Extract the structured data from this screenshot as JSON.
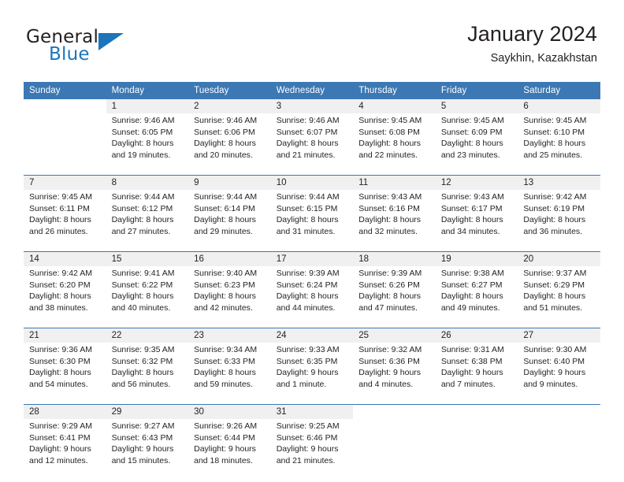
{
  "brand": {
    "name_part1": "General",
    "name_part2": "Blue",
    "logo_icon": "triangle-icon"
  },
  "header": {
    "month_title": "January 2024",
    "location": "Saykhin, Kazakhstan"
  },
  "colors": {
    "header_band": "#3c78b4",
    "daynum_band": "#f0f0f0",
    "brand_blue": "#1b75bb",
    "text": "#231f20"
  },
  "weekday_headers": [
    "Sunday",
    "Monday",
    "Tuesday",
    "Wednesday",
    "Thursday",
    "Friday",
    "Saturday"
  ],
  "weeks": [
    {
      "days": [
        {
          "num": "",
          "empty": true,
          "l1": "",
          "l2": "",
          "l3": "",
          "l4": ""
        },
        {
          "num": "1",
          "l1": "Sunrise: 9:46 AM",
          "l2": "Sunset: 6:05 PM",
          "l3": "Daylight: 8 hours",
          "l4": "and 19 minutes."
        },
        {
          "num": "2",
          "l1": "Sunrise: 9:46 AM",
          "l2": "Sunset: 6:06 PM",
          "l3": "Daylight: 8 hours",
          "l4": "and 20 minutes."
        },
        {
          "num": "3",
          "l1": "Sunrise: 9:46 AM",
          "l2": "Sunset: 6:07 PM",
          "l3": "Daylight: 8 hours",
          "l4": "and 21 minutes."
        },
        {
          "num": "4",
          "l1": "Sunrise: 9:45 AM",
          "l2": "Sunset: 6:08 PM",
          "l3": "Daylight: 8 hours",
          "l4": "and 22 minutes."
        },
        {
          "num": "5",
          "l1": "Sunrise: 9:45 AM",
          "l2": "Sunset: 6:09 PM",
          "l3": "Daylight: 8 hours",
          "l4": "and 23 minutes."
        },
        {
          "num": "6",
          "l1": "Sunrise: 9:45 AM",
          "l2": "Sunset: 6:10 PM",
          "l3": "Daylight: 8 hours",
          "l4": "and 25 minutes."
        }
      ]
    },
    {
      "days": [
        {
          "num": "7",
          "l1": "Sunrise: 9:45 AM",
          "l2": "Sunset: 6:11 PM",
          "l3": "Daylight: 8 hours",
          "l4": "and 26 minutes."
        },
        {
          "num": "8",
          "l1": "Sunrise: 9:44 AM",
          "l2": "Sunset: 6:12 PM",
          "l3": "Daylight: 8 hours",
          "l4": "and 27 minutes."
        },
        {
          "num": "9",
          "l1": "Sunrise: 9:44 AM",
          "l2": "Sunset: 6:14 PM",
          "l3": "Daylight: 8 hours",
          "l4": "and 29 minutes."
        },
        {
          "num": "10",
          "l1": "Sunrise: 9:44 AM",
          "l2": "Sunset: 6:15 PM",
          "l3": "Daylight: 8 hours",
          "l4": "and 31 minutes."
        },
        {
          "num": "11",
          "l1": "Sunrise: 9:43 AM",
          "l2": "Sunset: 6:16 PM",
          "l3": "Daylight: 8 hours",
          "l4": "and 32 minutes."
        },
        {
          "num": "12",
          "l1": "Sunrise: 9:43 AM",
          "l2": "Sunset: 6:17 PM",
          "l3": "Daylight: 8 hours",
          "l4": "and 34 minutes."
        },
        {
          "num": "13",
          "l1": "Sunrise: 9:42 AM",
          "l2": "Sunset: 6:19 PM",
          "l3": "Daylight: 8 hours",
          "l4": "and 36 minutes."
        }
      ]
    },
    {
      "days": [
        {
          "num": "14",
          "l1": "Sunrise: 9:42 AM",
          "l2": "Sunset: 6:20 PM",
          "l3": "Daylight: 8 hours",
          "l4": "and 38 minutes."
        },
        {
          "num": "15",
          "l1": "Sunrise: 9:41 AM",
          "l2": "Sunset: 6:22 PM",
          "l3": "Daylight: 8 hours",
          "l4": "and 40 minutes."
        },
        {
          "num": "16",
          "l1": "Sunrise: 9:40 AM",
          "l2": "Sunset: 6:23 PM",
          "l3": "Daylight: 8 hours",
          "l4": "and 42 minutes."
        },
        {
          "num": "17",
          "l1": "Sunrise: 9:39 AM",
          "l2": "Sunset: 6:24 PM",
          "l3": "Daylight: 8 hours",
          "l4": "and 44 minutes."
        },
        {
          "num": "18",
          "l1": "Sunrise: 9:39 AM",
          "l2": "Sunset: 6:26 PM",
          "l3": "Daylight: 8 hours",
          "l4": "and 47 minutes."
        },
        {
          "num": "19",
          "l1": "Sunrise: 9:38 AM",
          "l2": "Sunset: 6:27 PM",
          "l3": "Daylight: 8 hours",
          "l4": "and 49 minutes."
        },
        {
          "num": "20",
          "l1": "Sunrise: 9:37 AM",
          "l2": "Sunset: 6:29 PM",
          "l3": "Daylight: 8 hours",
          "l4": "and 51 minutes."
        }
      ]
    },
    {
      "days": [
        {
          "num": "21",
          "l1": "Sunrise: 9:36 AM",
          "l2": "Sunset: 6:30 PM",
          "l3": "Daylight: 8 hours",
          "l4": "and 54 minutes."
        },
        {
          "num": "22",
          "l1": "Sunrise: 9:35 AM",
          "l2": "Sunset: 6:32 PM",
          "l3": "Daylight: 8 hours",
          "l4": "and 56 minutes."
        },
        {
          "num": "23",
          "l1": "Sunrise: 9:34 AM",
          "l2": "Sunset: 6:33 PM",
          "l3": "Daylight: 8 hours",
          "l4": "and 59 minutes."
        },
        {
          "num": "24",
          "l1": "Sunrise: 9:33 AM",
          "l2": "Sunset: 6:35 PM",
          "l3": "Daylight: 9 hours",
          "l4": "and 1 minute."
        },
        {
          "num": "25",
          "l1": "Sunrise: 9:32 AM",
          "l2": "Sunset: 6:36 PM",
          "l3": "Daylight: 9 hours",
          "l4": "and 4 minutes."
        },
        {
          "num": "26",
          "l1": "Sunrise: 9:31 AM",
          "l2": "Sunset: 6:38 PM",
          "l3": "Daylight: 9 hours",
          "l4": "and 7 minutes."
        },
        {
          "num": "27",
          "l1": "Sunrise: 9:30 AM",
          "l2": "Sunset: 6:40 PM",
          "l3": "Daylight: 9 hours",
          "l4": "and 9 minutes."
        }
      ]
    },
    {
      "days": [
        {
          "num": "28",
          "l1": "Sunrise: 9:29 AM",
          "l2": "Sunset: 6:41 PM",
          "l3": "Daylight: 9 hours",
          "l4": "and 12 minutes."
        },
        {
          "num": "29",
          "l1": "Sunrise: 9:27 AM",
          "l2": "Sunset: 6:43 PM",
          "l3": "Daylight: 9 hours",
          "l4": "and 15 minutes."
        },
        {
          "num": "30",
          "l1": "Sunrise: 9:26 AM",
          "l2": "Sunset: 6:44 PM",
          "l3": "Daylight: 9 hours",
          "l4": "and 18 minutes."
        },
        {
          "num": "31",
          "l1": "Sunrise: 9:25 AM",
          "l2": "Sunset: 6:46 PM",
          "l3": "Daylight: 9 hours",
          "l4": "and 21 minutes."
        },
        {
          "num": "",
          "empty": true,
          "l1": "",
          "l2": "",
          "l3": "",
          "l4": ""
        },
        {
          "num": "",
          "empty": true,
          "l1": "",
          "l2": "",
          "l3": "",
          "l4": ""
        },
        {
          "num": "",
          "empty": true,
          "l1": "",
          "l2": "",
          "l3": "",
          "l4": ""
        }
      ]
    }
  ]
}
